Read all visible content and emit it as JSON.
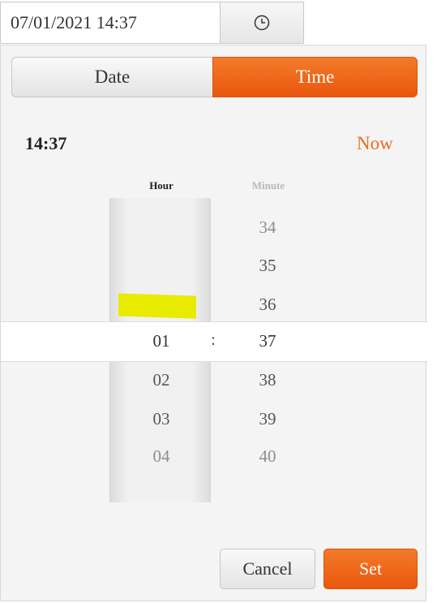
{
  "input": {
    "value": "07/01/2021 14:37"
  },
  "clock_button": {
    "icon": "clock-icon"
  },
  "tabs": [
    {
      "label": "Date",
      "active": false
    },
    {
      "label": "Time",
      "active": true
    }
  ],
  "current_time": "14:37",
  "now_label": "Now",
  "hour_header": "Hour",
  "minute_header": "Minute",
  "hours": [
    "01",
    "02",
    "03",
    "04"
  ],
  "minutes": [
    "34",
    "35",
    "36",
    "37",
    "38",
    "39",
    "40"
  ],
  "separator": ":",
  "buttons": {
    "cancel": "Cancel",
    "set": "Set"
  },
  "colors": {
    "accent": "#ee6b1c",
    "highlight": "#e8ea00"
  }
}
